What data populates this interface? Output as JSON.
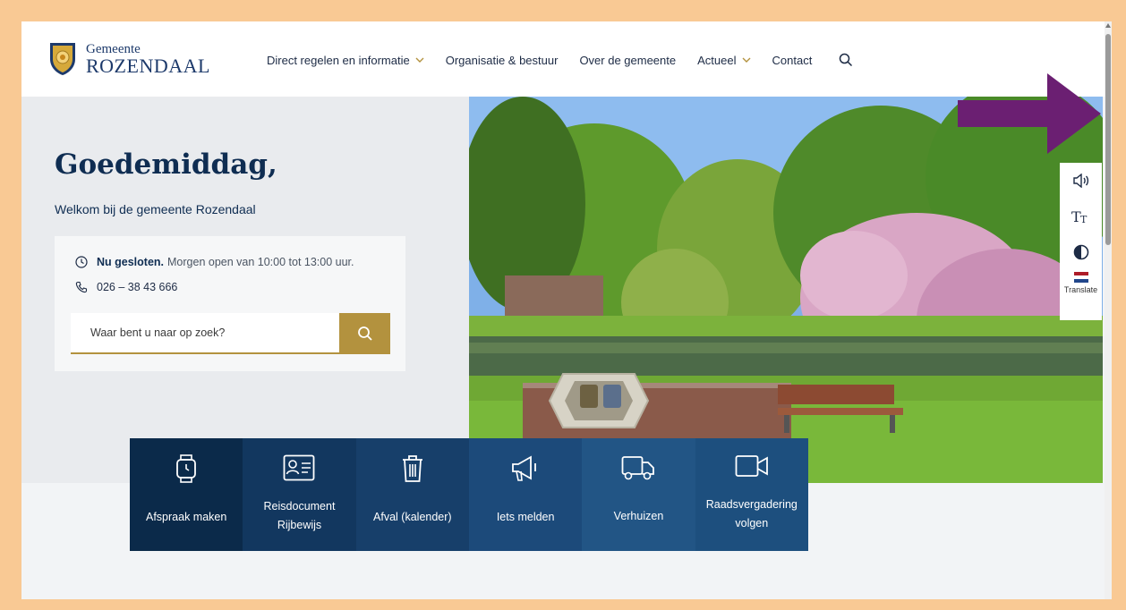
{
  "header": {
    "logo_line1": "Gemeente",
    "logo_line2": "ROZENDAAL",
    "nav": [
      {
        "label": "Direct regelen en informatie",
        "has_dropdown": true
      },
      {
        "label": "Organisatie & bestuur",
        "has_dropdown": false
      },
      {
        "label": "Over de gemeente",
        "has_dropdown": false
      },
      {
        "label": "Actueel",
        "has_dropdown": true
      },
      {
        "label": "Contact",
        "has_dropdown": false
      }
    ]
  },
  "hero": {
    "greeting": "Goedemiddag,",
    "welcome": "Welkom bij de gemeente Rozendaal",
    "status_bold": "Nu gesloten.",
    "status_rest": "Morgen open van 10:00 tot 13:00 uur.",
    "phone": "026 – 38 43 666",
    "search_placeholder": "Waar bent u naar op zoek?"
  },
  "accessibility": {
    "translate_label": "Translate"
  },
  "tiles": [
    {
      "label": "Afspraak maken",
      "icon": "smartwatch-icon"
    },
    {
      "label": "Reisdocument Rijbewijs",
      "icon": "id-card-icon"
    },
    {
      "label": "Afval (kalender)",
      "icon": "trash-icon"
    },
    {
      "label": "Iets melden",
      "icon": "megaphone-icon"
    },
    {
      "label": "Verhuizen",
      "icon": "truck-icon"
    },
    {
      "label": "Raadsvergadering volgen",
      "icon": "video-icon"
    }
  ],
  "colors": {
    "navy": "#0f2d52",
    "gold": "#b3923e",
    "frame": "#f9c994",
    "arrow": "#6b1f72"
  }
}
